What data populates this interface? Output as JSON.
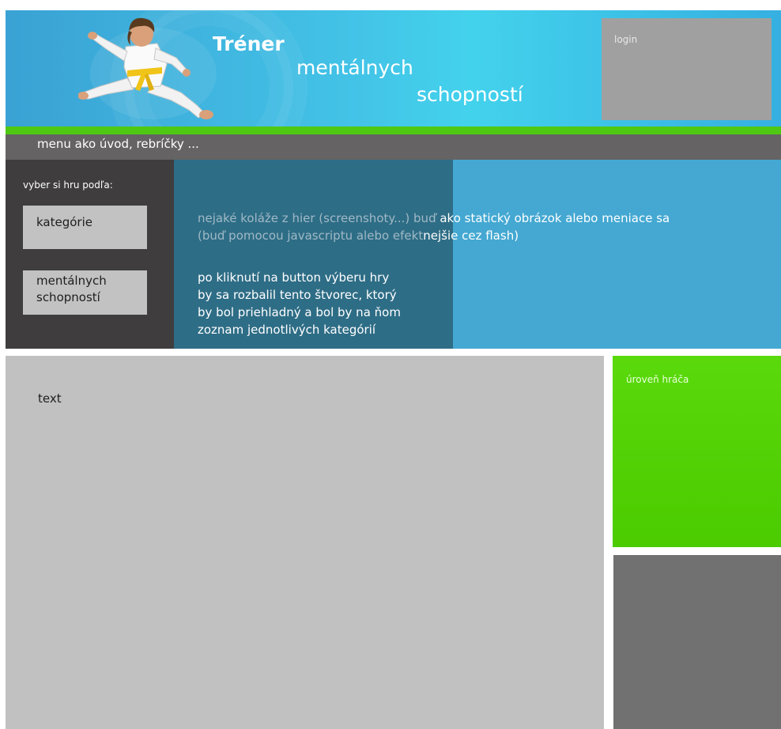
{
  "header": {
    "title_line1": "Tréner",
    "title_line2": "mentálnych",
    "title_line3": "schopností",
    "login_label": "login",
    "hero_icon": "karate-kid-jump-kick-image",
    "colors": {
      "gradient_left": "#3aa2d4",
      "gradient_mid": "#43d2ec",
      "gradient_right": "#35b0e1"
    }
  },
  "menu": {
    "text": "menu ako úvod, rebríčky ..."
  },
  "sidebar": {
    "label": "vyber si hru podľa:",
    "buttons": [
      {
        "line1": "kategórie",
        "line2": ""
      },
      {
        "line1": "mentálnych",
        "line2": "schopností"
      }
    ]
  },
  "banner": {
    "note_line1_dim": "nejaké koláže z hier (screenshoty...) buď",
    "note_line1_bright": " ako statický obrázok alebo meniace sa",
    "note_line2_dim": "(buď pomocou javascriptu alebo efekt",
    "note_line2_bright": "nejšie cez flash)",
    "dropdown_lines": [
      "po kliknutí na button výberu hry",
      "by sa rozbalil tento štvorec, ktorý",
      "by bol priehladný a bol by na ňom",
      "zoznam jednotlivých kategórií"
    ]
  },
  "content": {
    "text": "text"
  },
  "right_column": {
    "player_level_label": "úroveň hráča"
  },
  "colors": {
    "accent_green": "#4fc814",
    "menu_bar": "#656363",
    "sidebar_bg": "#3f3d3e",
    "banner_bg": "#44a8d2",
    "overlay_bg": "#2e6d86",
    "content_bg": "#c1c1c1",
    "player_level_bg": "#4bcc00",
    "gray_box": "#717171"
  }
}
